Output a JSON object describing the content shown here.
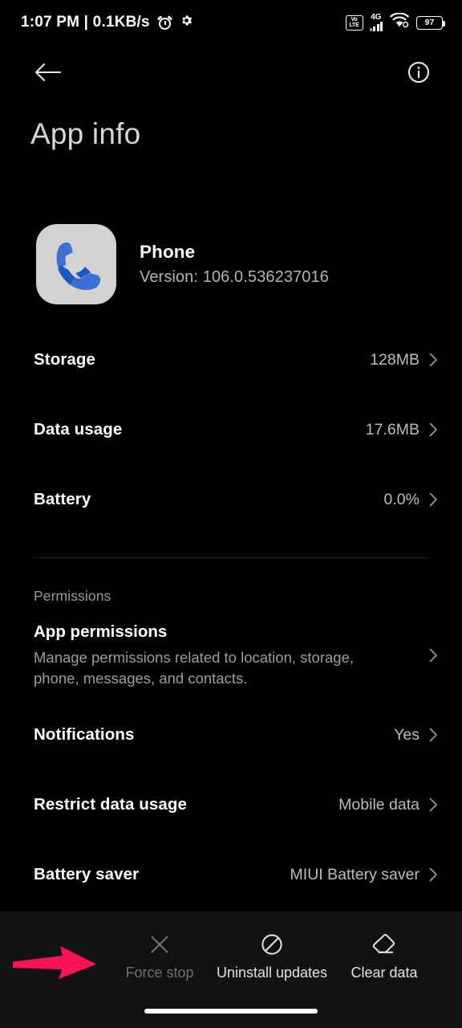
{
  "status_bar": {
    "clock": "1:07 PM | 0.1KB/s",
    "alarm_icon": "alarm-icon",
    "settings_icon": "gear-icon",
    "volte_top": "Vo",
    "volte_bottom": "LTE",
    "network_type": "4G",
    "wifi_icon": "wifi-icon",
    "battery_level": "97"
  },
  "app_bar": {
    "back_icon": "back-arrow-icon",
    "info_icon": "info-circle-icon",
    "title": "App info"
  },
  "app_header": {
    "icon": "phone-app-icon",
    "name": "Phone",
    "version": "Version: 106.0.536237016"
  },
  "usage_rows": [
    {
      "label": "Storage",
      "value": "128MB"
    },
    {
      "label": "Data usage",
      "value": "17.6MB"
    },
    {
      "label": "Battery",
      "value": "0.0%"
    }
  ],
  "permissions_section": {
    "heading": "Permissions",
    "app_permissions": {
      "title": "App permissions",
      "subtitle": "Manage permissions related to location, storage, phone, messages, and contacts."
    },
    "rows": [
      {
        "label": "Notifications",
        "value": "Yes"
      },
      {
        "label": "Restrict data usage",
        "value": "Mobile data"
      },
      {
        "label": "Battery saver",
        "value": "MIUI Battery saver"
      }
    ]
  },
  "bottom_actions": [
    {
      "label": "Force stop",
      "icon": "close-x-icon",
      "enabled": false
    },
    {
      "label": "Uninstall updates",
      "icon": "block-circle-icon",
      "enabled": true
    },
    {
      "label": "Clear data",
      "icon": "eraser-icon",
      "enabled": true
    }
  ],
  "annotation": {
    "arrow_color": "#FA1457",
    "points_at": "Force stop"
  },
  "colors": {
    "background": "#000000",
    "bottom_bar": "#121212",
    "primary_text": "#FFFFFF",
    "secondary_text": "#BDBDBD",
    "muted_text": "#9A9A9A",
    "app_icon_bg": "#D2D2D2",
    "phone_blue": "#1A56C4"
  }
}
